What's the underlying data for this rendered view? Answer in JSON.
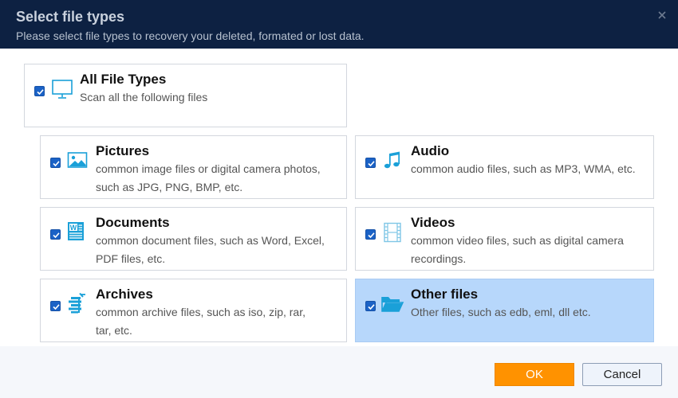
{
  "dialog": {
    "title": "Select file types",
    "subtitle": "Please select file types to recovery your deleted, formated or lost data."
  },
  "all_types": {
    "title": "All File Types",
    "desc": "Scan all the following files",
    "checked": true
  },
  "types": [
    {
      "title": "Pictures",
      "desc": "common image files or digital camera photos, such as JPG, PNG, BMP, etc.",
      "icon": "picture-icon",
      "checked": true
    },
    {
      "title": "Audio",
      "desc": "common audio files, such as MP3, WMA, etc.",
      "icon": "music-note-icon",
      "checked": true
    },
    {
      "title": "Documents",
      "desc": "common document files, such as Word, Excel, PDF files, etc.",
      "icon": "word-document-icon",
      "checked": true
    },
    {
      "title": "Videos",
      "desc": "common video files, such as digital camera recordings.",
      "icon": "film-strip-icon",
      "checked": true
    },
    {
      "title": "Archives",
      "desc": "common archive files, such as iso, zip, rar, tar, etc.",
      "icon": "archive-icon",
      "checked": true
    },
    {
      "title": "Other files",
      "desc": "Other files, such as edb, eml, dll etc.",
      "icon": "folder-icon",
      "checked": true,
      "selected": true
    }
  ],
  "buttons": {
    "ok": "OK",
    "cancel": "Cancel"
  },
  "colors": {
    "header_bg": "#0d2142",
    "accent_icon": "#1aa0d8",
    "checkbox": "#1b62c6",
    "selected_card": "#b7d7fb",
    "ok_button": "#ff9200"
  }
}
